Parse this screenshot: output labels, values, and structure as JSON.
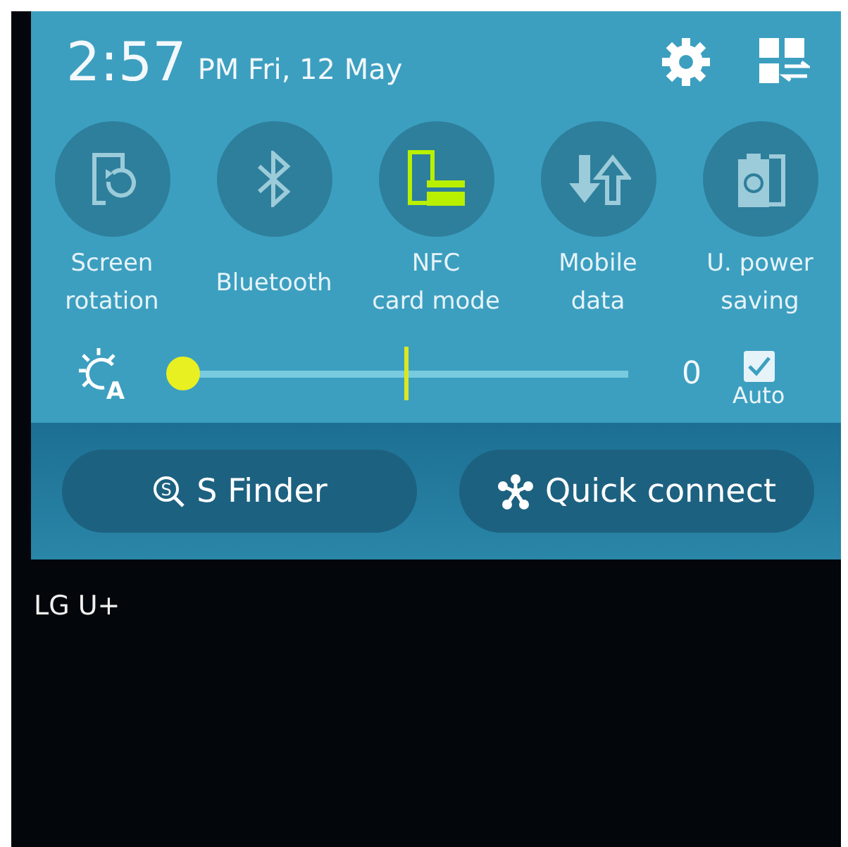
{
  "header": {
    "time": "2:57",
    "date": "PM Fri, 12 May"
  },
  "tiles": [
    {
      "kind": "rotation",
      "label": "Screen\nrotation",
      "on": false
    },
    {
      "kind": "bluetooth",
      "label": "Bluetooth",
      "on": false
    },
    {
      "kind": "nfc",
      "label": "NFC\ncard mode",
      "on": true
    },
    {
      "kind": "data",
      "label": "Mobile\ndata",
      "on": false
    },
    {
      "kind": "power",
      "label": "U. power\nsaving",
      "on": false
    }
  ],
  "brightness": {
    "icon_text": "A",
    "level": 0,
    "reading": "0",
    "auto": {
      "label": "Auto",
      "checked": true
    }
  },
  "buttons": [
    {
      "kind": "finder",
      "icon_text": "S",
      "label": "S Finder"
    },
    {
      "kind": "connect",
      "label": "Quick connect"
    }
  ],
  "carrier": "LG U+"
}
